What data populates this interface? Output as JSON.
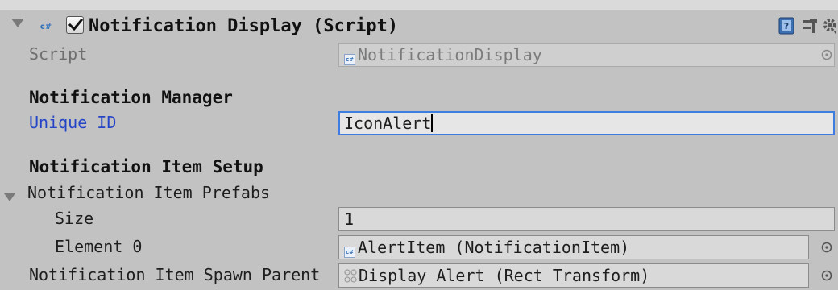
{
  "component": {
    "title": "Notification Display (Script)",
    "script_label": "Script",
    "script_value": "NotificationDisplay"
  },
  "sections": {
    "manager_title": "Notification Manager",
    "item_setup_title": "Notification Item Setup"
  },
  "fields": {
    "unique_id_label": "Unique ID",
    "unique_id_value": "IconAlert",
    "prefabs_label": "Notification Item Prefabs",
    "size_label": "Size",
    "size_value": "1",
    "element0_label": "Element 0",
    "element0_value": "AlertItem (NotificationItem)",
    "spawn_parent_label": "Notification Item Spawn Parent",
    "spawn_parent_value": "Display Alert (Rect Transform)"
  },
  "icons": {
    "foldout": "triangle-down-icon",
    "script_asset": "cs-script-icon",
    "enabled_checkbox": "checkmark-icon",
    "help": "help-book-icon",
    "presets": "presets-icon",
    "settings": "gear-icon",
    "object_picker": "target-circle-icon",
    "rect_transform": "rect-transform-icon"
  },
  "colors": {
    "background": "#c2c2c2",
    "label_modified": "#2545c7",
    "focus_border": "#3e7de0"
  }
}
